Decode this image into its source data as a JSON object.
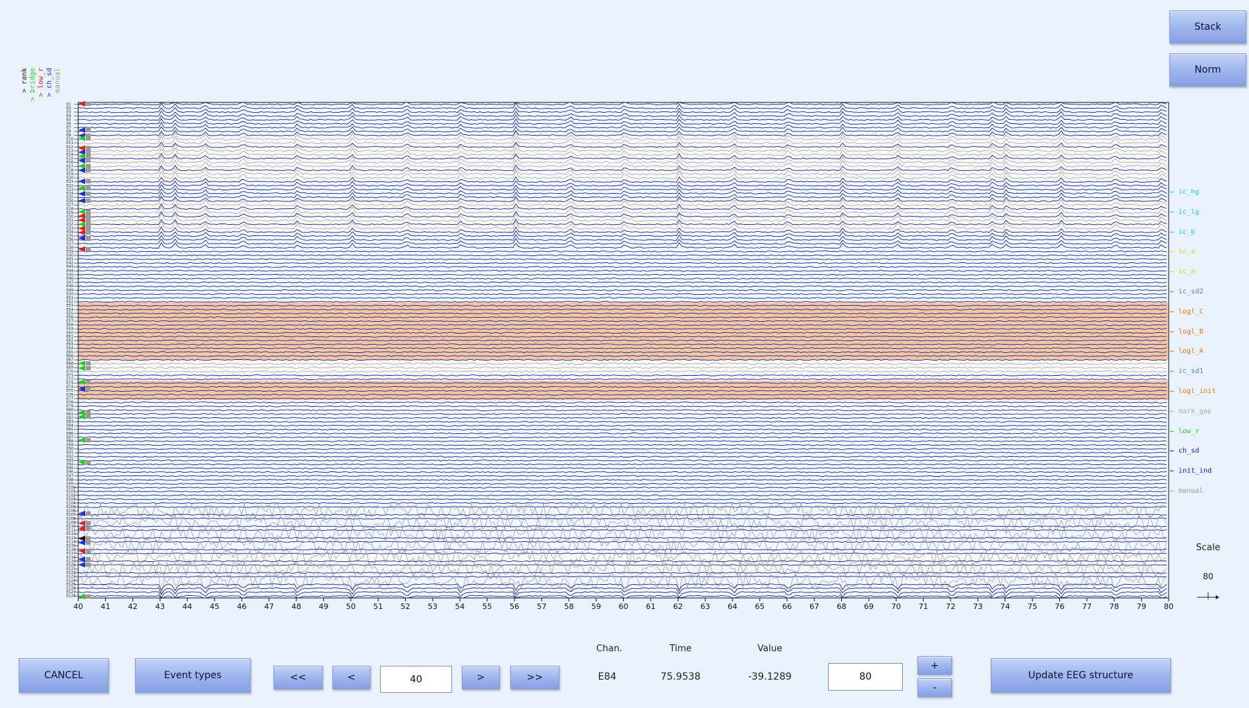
{
  "header": {
    "stack_label": "Stack",
    "norm_label": "Norm"
  },
  "legend_top": [
    {
      "text": "> rank",
      "color": "#222222"
    },
    {
      "text": "> bridge",
      "color": "#33cc33"
    },
    {
      "text": "> low_r",
      "color": "#e02020"
    },
    {
      "text": "> ch_sd",
      "color": "#2030d0"
    },
    {
      "text": "manual",
      "color": "#9a9a9a"
    }
  ],
  "right_labels": [
    {
      "text": "ic_hg",
      "color": "#22c8d8"
    },
    {
      "text": "ic_lg",
      "color": "#22c8d8"
    },
    {
      "text": "ic_b",
      "color": "#22c8d8"
    },
    {
      "text": "ic_a",
      "color": "#e8d020"
    },
    {
      "text": "ic_m",
      "color": "#e8d020"
    },
    {
      "text": "ic_sd2",
      "color": "#5a8c96"
    },
    {
      "text": "logl_C",
      "color": "#e07820"
    },
    {
      "text": "logl_B",
      "color": "#e07820"
    },
    {
      "text": "logl_A",
      "color": "#e07820"
    },
    {
      "text": "ic_sd1",
      "color": "#5a8c96"
    },
    {
      "text": "logl_init",
      "color": "#e07820"
    },
    {
      "text": "mark_gap",
      "color": "#b0b0b0"
    },
    {
      "text": "low_r",
      "color": "#22cc22"
    },
    {
      "text": "ch_sd",
      "color": "#2020cc"
    },
    {
      "text": "init_ind",
      "color": "#2020cc"
    },
    {
      "text": "manual",
      "color": "#9a9a9a"
    }
  ],
  "xaxis": {
    "ticks": [
      "40",
      "41",
      "42",
      "43",
      "44",
      "45",
      "46",
      "47",
      "48",
      "49",
      "50",
      "51",
      "52",
      "53",
      "54",
      "55",
      "56",
      "57",
      "58",
      "59",
      "60",
      "61",
      "62",
      "63",
      "64",
      "65",
      "66",
      "67",
      "68",
      "69",
      "70",
      "71",
      "72",
      "73",
      "74",
      "75",
      "76",
      "77",
      "78",
      "79",
      "80"
    ],
    "range": [
      40,
      80
    ]
  },
  "plot": {
    "channel_count": 128,
    "highlight_color": "#f6c7a6",
    "trace_color": "#1a2a8a",
    "flagged_trace_color": "#9a9a9a"
  },
  "scale": {
    "label": "Scale",
    "value": "80"
  },
  "footer": {
    "cancel_label": "CANCEL",
    "event_types_label": "Event types",
    "first_label": "<<",
    "prev_label": "<",
    "time_input_value": "40",
    "next_label": ">",
    "last_label": ">>",
    "chan_header": "Chan.",
    "time_header": "Time",
    "value_header": "Value",
    "chan_value": "E84",
    "time_value": "75.9538",
    "value_value": "-39.1289",
    "scale_input_value": "80",
    "plus_label": "+",
    "minus_label": "-",
    "update_label": "Update EEG structure"
  }
}
